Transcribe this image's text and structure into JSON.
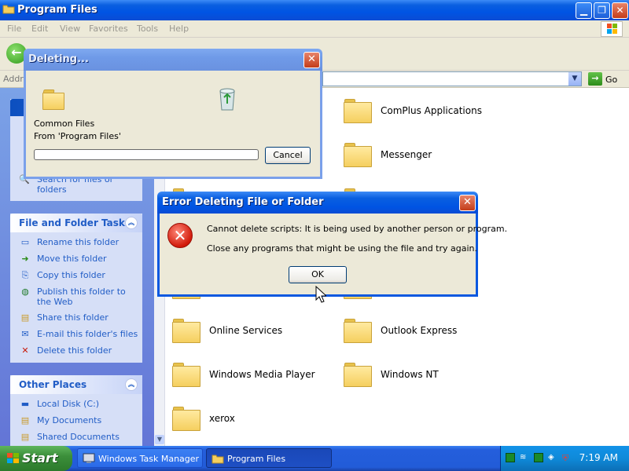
{
  "window": {
    "title": "Program Files"
  },
  "menu": [
    "File",
    "Edit",
    "View",
    "Favorites",
    "Tools",
    "Help"
  ],
  "address": {
    "label": "Addre",
    "go": "Go"
  },
  "left_panels": {
    "partial_task": "Search for files or\nfolders",
    "file_tasks": {
      "title": "File and Folder Tasks",
      "items": [
        "Rename this folder",
        "Move this folder",
        "Copy this folder",
        "Publish this folder to the Web",
        "Share this folder",
        "E-mail this folder's files",
        "Delete this folder"
      ]
    },
    "other_places": {
      "title": "Other Places",
      "items": [
        "Local Disk (C:)",
        "My Documents",
        "Shared Documents"
      ]
    }
  },
  "folders": [
    {
      "label": "ComPlus Applications"
    },
    {
      "label": "Messenger"
    },
    {
      "label": "Online Services"
    },
    {
      "label": "Outlook Express"
    },
    {
      "label": "Windows Media Player"
    },
    {
      "label": "Windows NT"
    },
    {
      "label": "xerox"
    }
  ],
  "deleting_dialog": {
    "title": "Deleting...",
    "item": "Common Files",
    "from": "From 'Program Files'",
    "progress": 0.0,
    "cancel": "Cancel"
  },
  "error_dialog": {
    "title": "Error Deleting File or Folder",
    "message": "Cannot delete scripts: It is being used by another person or program.",
    "hint": "Close any programs that might be using the file and try again.",
    "ok": "OK"
  },
  "taskbar": {
    "start": "Start",
    "buttons": [
      "Windows Task Manager",
      "Program Files"
    ],
    "clock": "7:19 AM"
  },
  "colors": {
    "accent": "#0054e3",
    "task_link": "#215dc6",
    "error_red": "#d11a0a"
  }
}
